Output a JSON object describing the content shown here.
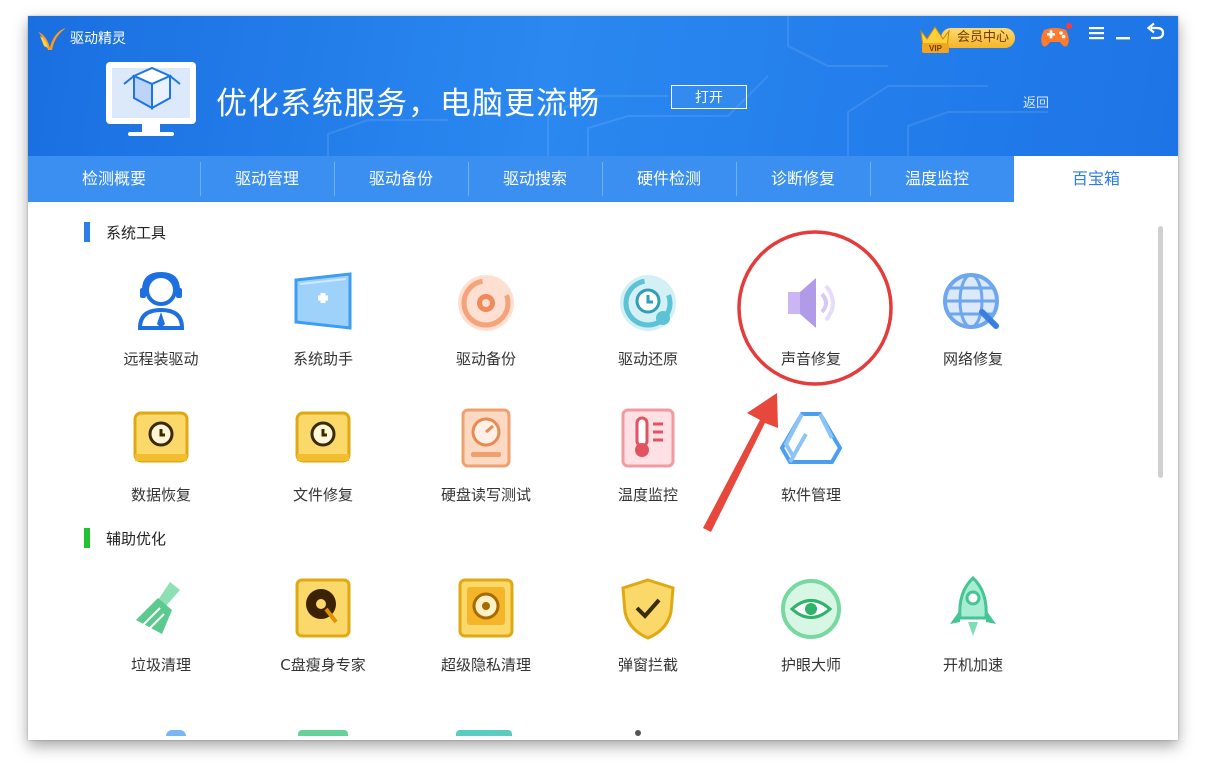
{
  "app": {
    "name": "驱动精灵"
  },
  "banner": {
    "headline": "优化系统服务，电脑更流畅",
    "open_button": "打开",
    "back_link": "返回"
  },
  "titlebar": {
    "vip_badge": "VIP",
    "vip_label": "会员中心"
  },
  "tabs": [
    {
      "label": "检测概要"
    },
    {
      "label": "驱动管理"
    },
    {
      "label": "驱动备份"
    },
    {
      "label": "驱动搜索"
    },
    {
      "label": "硬件检测"
    },
    {
      "label": "诊断修复"
    },
    {
      "label": "温度监控"
    },
    {
      "label": "百宝箱",
      "active": true
    }
  ],
  "sections": [
    {
      "title": "系统工具",
      "color": "#2e7de8",
      "tools": [
        {
          "label": "远程装驱动",
          "icon": "support-agent-icon"
        },
        {
          "label": "系统助手",
          "icon": "system-assistant-icon"
        },
        {
          "label": "驱动备份",
          "icon": "driver-backup-icon"
        },
        {
          "label": "驱动还原",
          "icon": "driver-restore-icon"
        },
        {
          "label": "声音修复",
          "icon": "speaker-icon",
          "highlighted": true
        },
        {
          "label": "网络修复",
          "icon": "network-repair-icon"
        },
        {
          "label": "数据恢复",
          "icon": "data-recovery-icon"
        },
        {
          "label": "文件修复",
          "icon": "file-repair-icon"
        },
        {
          "label": "硬盘读写测试",
          "icon": "disk-test-icon"
        },
        {
          "label": "温度监控",
          "icon": "thermometer-icon"
        },
        {
          "label": "软件管理",
          "icon": "software-manager-icon"
        }
      ]
    },
    {
      "title": "辅助优化",
      "color": "#22c230",
      "tools": [
        {
          "label": "垃圾清理",
          "icon": "broom-icon"
        },
        {
          "label": "C盘瘦身专家",
          "icon": "disk-slim-icon"
        },
        {
          "label": "超级隐私清理",
          "icon": "privacy-safe-icon"
        },
        {
          "label": "弹窗拦截",
          "icon": "shield-check-icon"
        },
        {
          "label": "护眼大师",
          "icon": "eye-care-icon"
        },
        {
          "label": "开机加速",
          "icon": "rocket-icon"
        }
      ]
    }
  ],
  "colors": {
    "header_blue": "#1f78e8",
    "tab_blue": "#3b8ff0",
    "annotation_red": "#e53b3b"
  }
}
